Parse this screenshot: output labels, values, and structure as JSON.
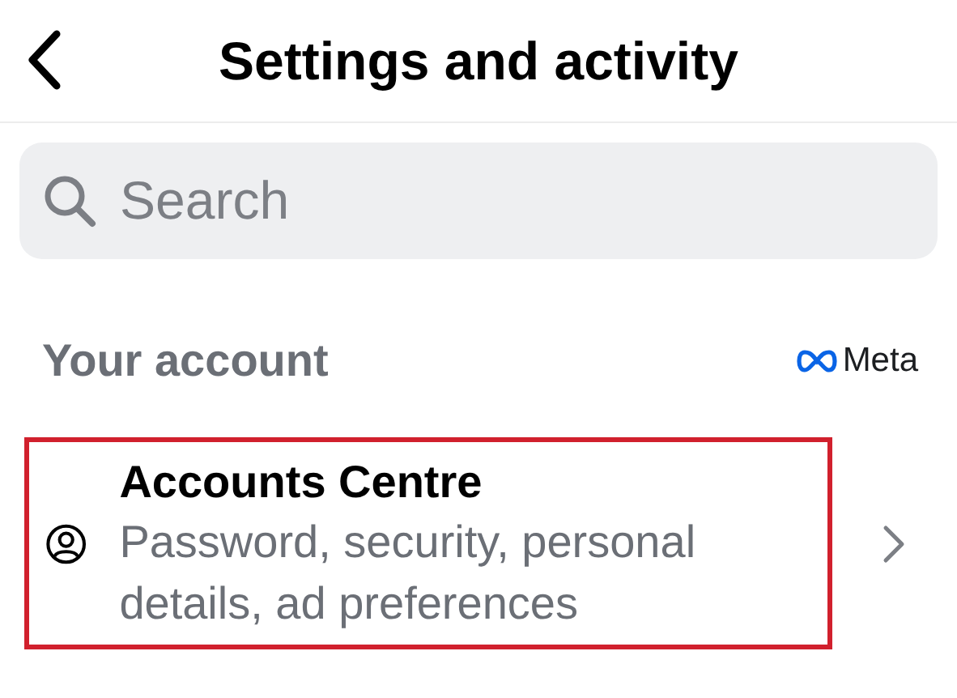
{
  "header": {
    "title": "Settings and activity"
  },
  "search": {
    "placeholder": "Search"
  },
  "section": {
    "title": "Your account",
    "brand": "Meta"
  },
  "items": [
    {
      "title": "Accounts Centre",
      "subtitle": "Password, security, personal details, ad preferences",
      "highlighted": true
    }
  ]
}
